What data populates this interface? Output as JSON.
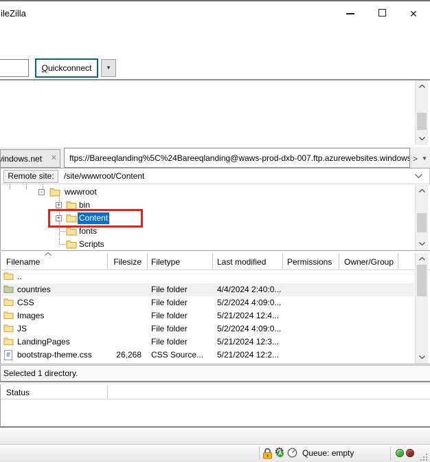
{
  "window": {
    "title_fragment": "ileZilla"
  },
  "glyphs": {
    "close": "✕",
    "tab_close": "✕",
    "dropdown": "▼",
    "tab_scroll_right": ">",
    "gear_badge": "A",
    "css_hash": "#"
  },
  "toolbar": {
    "quickconnect_initial": "Q",
    "quickconnect_rest": "uickconnect"
  },
  "tabs": {
    "inactive_label": "windows.net",
    "active_label": "ftps://Bareeqlanding%5C%24Bareeqlanding@waws-prod-dxb-007.ftp.azurewebsites.windows."
  },
  "remote_site": {
    "label": "Remote site:",
    "value": "/site/wwwroot/Content"
  },
  "tree": {
    "items": [
      {
        "label": "wwwroot",
        "expander": "-",
        "selected": false
      },
      {
        "label": "bin",
        "expander": "+",
        "selected": false
      },
      {
        "label": "Content",
        "expander": "+",
        "selected": true
      },
      {
        "label": "fonts",
        "expander": "",
        "selected": false
      },
      {
        "label": "Scripts",
        "expander": "",
        "selected": false
      }
    ],
    "annotation_color": "#e0241b"
  },
  "file_list": {
    "columns": [
      "Filename",
      "Filesize",
      "Filetype",
      "Last modified",
      "Permissions",
      "Owner/Group"
    ],
    "rows": [
      {
        "name": "..",
        "size": "",
        "type": "",
        "modified": ""
      },
      {
        "name": "countries",
        "size": "",
        "type": "File folder",
        "modified": "4/4/2024 2:40:0..."
      },
      {
        "name": "CSS",
        "size": "",
        "type": "File folder",
        "modified": "5/2/2024 4:09:0..."
      },
      {
        "name": "Images",
        "size": "",
        "type": "File folder",
        "modified": "5/21/2024 12:4..."
      },
      {
        "name": "JS",
        "size": "",
        "type": "File folder",
        "modified": "5/2/2024 4:09:0..."
      },
      {
        "name": "LandingPages",
        "size": "",
        "type": "File folder",
        "modified": "5/21/2024 12:3..."
      },
      {
        "name": "bootstrap-theme.css",
        "size": "26,268",
        "type": "CSS Source...",
        "modified": "5/21/2024 12:2..."
      }
    ],
    "status": "Selected 1 directory."
  },
  "queue_panel": {
    "status_header": "Status"
  },
  "status_bar": {
    "queue_label": "Queue: empty"
  },
  "colors": {
    "selection": "#0a6ed1",
    "annotation": "#e0241b",
    "folder": "#f2d579",
    "folder_green": "#b5c596"
  }
}
